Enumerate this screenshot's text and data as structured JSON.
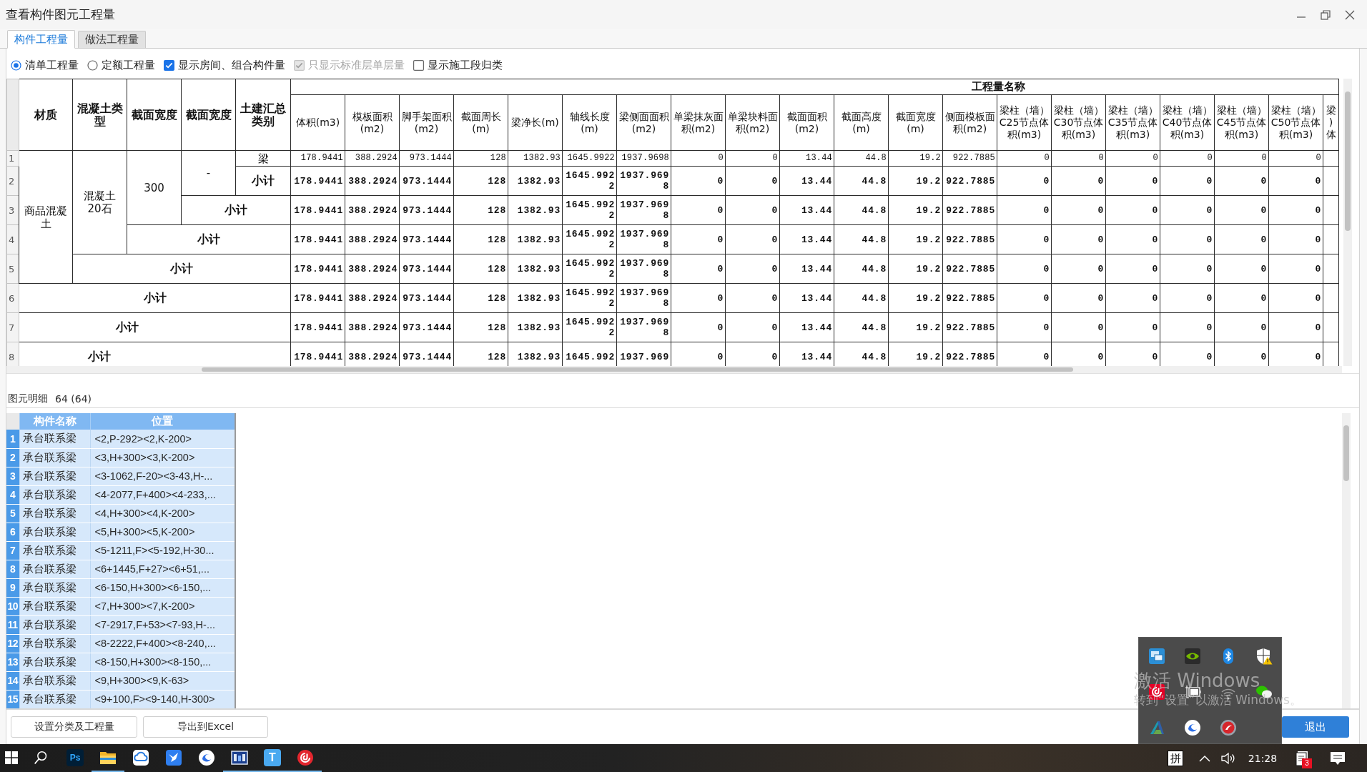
{
  "window": {
    "title": "查看构件图元工程量"
  },
  "tabs": [
    {
      "label": "构件工程量",
      "selected": true
    },
    {
      "label": "做法工程量",
      "selected": false
    }
  ],
  "options": [
    {
      "kind": "radio",
      "label": "清单工程量",
      "selected": true,
      "disabled": false
    },
    {
      "kind": "radio",
      "label": "定额工程量",
      "selected": false,
      "disabled": false
    },
    {
      "kind": "checkbox",
      "label": "显示房间、组合构件量",
      "checked": true,
      "disabled": false
    },
    {
      "kind": "checkbox",
      "label": "只显示标准层单层量",
      "checked": true,
      "disabled": true
    },
    {
      "kind": "checkbox",
      "label": "显示施工段归类",
      "checked": false,
      "disabled": false
    }
  ],
  "quantity_table": {
    "label_columns": [
      "材质",
      "混凝土类型",
      "截面宽度",
      "截面宽度",
      "土建汇总类别"
    ],
    "group_header": "工程量名称",
    "value_columns": [
      "体积(m3)",
      "模板面积(m2)",
      "脚手架面积(m2)",
      "截面周长(m)",
      "梁净长(m)",
      "轴线长度(m)",
      "梁侧面面积(m2)",
      "单梁抹灰面积(m2)",
      "单梁块料面积(m2)",
      "截面面积(m2)",
      "截面高度(m)",
      "截面宽度(m)",
      "侧面模板面积(m2)",
      "梁柱（墙）C25节点体积(m3)",
      "梁柱（墙）C30节点体积(m3)",
      "梁柱（墙）C35节点体积(m3)",
      "梁柱（墙）C40节点体积(m3)",
      "梁柱（墙）C45节点体积(m3)",
      "梁柱（墙）C50节点体积(m3)",
      "梁 ) 体"
    ],
    "groups": [
      {
        "label": "商品混凝土",
        "children": [
          {
            "label": "混凝土20石",
            "children": [
              {
                "label": "300",
                "children": [
                  {
                    "label": "-",
                    "children": [
                      {
                        "no": "1",
                        "label": "梁",
                        "values": [
                          "178.9441",
                          "388.2924",
                          "973.1444",
                          "128",
                          "1382.93",
                          "1645.9922",
                          "1937.9698",
                          "0",
                          "0",
                          "13.44",
                          "44.8",
                          "19.2",
                          "922.7885",
                          "0",
                          "0",
                          "0",
                          "0",
                          "0",
                          "0"
                        ]
                      }
                    ],
                    "subtotal": {
                      "no": "2",
                      "label": "小计",
                      "values": [
                        "178.9441",
                        "388.2924",
                        "973.1444",
                        "128",
                        "1382.93",
                        "1645.9922",
                        "1937.9698",
                        "0",
                        "0",
                        "13.44",
                        "44.8",
                        "19.2",
                        "922.7885",
                        "0",
                        "0",
                        "0",
                        "0",
                        "0",
                        "0"
                      ]
                    }
                  }
                ],
                "subtotal": {
                  "no": "3",
                  "label": "小计",
                  "values": [
                    "178.9441",
                    "388.2924",
                    "973.1444",
                    "128",
                    "1382.93",
                    "1645.9922",
                    "1937.9698",
                    "0",
                    "0",
                    "13.44",
                    "44.8",
                    "19.2",
                    "922.7885",
                    "0",
                    "0",
                    "0",
                    "0",
                    "0",
                    "0"
                  ]
                }
              }
            ],
            "subtotal": {
              "no": "4",
              "label": "小计",
              "values": [
                "178.9441",
                "388.2924",
                "973.1444",
                "128",
                "1382.93",
                "1645.9922",
                "1937.9698",
                "0",
                "0",
                "13.44",
                "44.8",
                "19.2",
                "922.7885",
                "0",
                "0",
                "0",
                "0",
                "0",
                "0"
              ]
            }
          }
        ],
        "subtotal": {
          "no": "5",
          "label": "小计",
          "values": [
            "178.9441",
            "388.2924",
            "973.1444",
            "128",
            "1382.93",
            "1645.9922",
            "1937.9698",
            "0",
            "0",
            "13.44",
            "44.8",
            "19.2",
            "922.7885",
            "0",
            "0",
            "0",
            "0",
            "0",
            "0"
          ]
        }
      }
    ],
    "outer_subtotals": [
      {
        "no": "6",
        "label": "小计",
        "values": [
          "178.9441",
          "388.2924",
          "973.1444",
          "128",
          "1382.93",
          "1645.9922",
          "1937.9698",
          "0",
          "0",
          "13.44",
          "44.8",
          "19.2",
          "922.7885",
          "0",
          "0",
          "0",
          "0",
          "0",
          "0"
        ]
      },
      {
        "no": "7",
        "label": "小计",
        "values": [
          "178.9441",
          "388.2924",
          "973.1444",
          "128",
          "1382.93",
          "1645.9922",
          "1937.9698",
          "0",
          "0",
          "13.44",
          "44.8",
          "19.2",
          "922.7885",
          "0",
          "0",
          "0",
          "0",
          "0",
          "0"
        ]
      },
      {
        "no": "8",
        "label": "小计",
        "values": [
          "178.9441",
          "388.2924",
          "973.1444",
          "128",
          "1382.93",
          "1645.992",
          "1937.969",
          "0",
          "0",
          "13.44",
          "44.8",
          "19.2",
          "922.7885",
          "0",
          "0",
          "0",
          "0",
          "0",
          "0"
        ]
      }
    ]
  },
  "detail": {
    "title": "图元明细",
    "count": "64 (64)",
    "columns": [
      "构件名称",
      "位置"
    ],
    "rows": [
      {
        "no": "1",
        "name": "承台联系梁",
        "position": "<2,P-292><2,K-200>",
        "selected": true
      },
      {
        "no": "2",
        "name": "承台联系梁",
        "position": "<3,H+300><3,K-200>",
        "selected": true
      },
      {
        "no": "3",
        "name": "承台联系梁",
        "position": "<3-1062,F-20><3-43,H-...",
        "selected": true
      },
      {
        "no": "4",
        "name": "承台联系梁",
        "position": "<4-2077,F+400><4-233,...",
        "selected": true
      },
      {
        "no": "5",
        "name": "承台联系梁",
        "position": "<4,H+300><4,K-200>",
        "selected": true
      },
      {
        "no": "6",
        "name": "承台联系梁",
        "position": "<5,H+300><5,K-200>",
        "selected": true
      },
      {
        "no": "7",
        "name": "承台联系梁",
        "position": "<5-1211,F><5-192,H-30...",
        "selected": true
      },
      {
        "no": "8",
        "name": "承台联系梁",
        "position": "<6+1445,F+27><6+51,...",
        "selected": true
      },
      {
        "no": "9",
        "name": "承台联系梁",
        "position": "<6-150,H+300><6-150,...",
        "selected": true
      },
      {
        "no": "10",
        "name": "承台联系梁",
        "position": "<7,H+300><7,K-200>",
        "selected": true
      },
      {
        "no": "11",
        "name": "承台联系梁",
        "position": "<7-2917,F+53><7-93,H-...",
        "selected": true
      },
      {
        "no": "12",
        "name": "承台联系梁",
        "position": "<8-2222,F+400><8-240,...",
        "selected": true
      },
      {
        "no": "13",
        "name": "承台联系梁",
        "position": "<8-150,H+300><8-150,...",
        "selected": true
      },
      {
        "no": "14",
        "name": "承台联系梁",
        "position": "<9,H+300><9,K-63>",
        "selected": true
      },
      {
        "no": "15",
        "name": "承台联系梁",
        "position": "<9+100,F><9-140,H-300>",
        "selected": true
      }
    ]
  },
  "footer": {
    "buttons": [
      "设置分类及工程量",
      "导出到Excel"
    ],
    "exit": "退出"
  },
  "taskbar": {
    "apps": [
      {
        "kind": "photo",
        "label": "Ps",
        "running": false
      },
      {
        "kind": "folder",
        "running": true
      },
      {
        "kind": "cloud",
        "running": false
      },
      {
        "kind": "bird",
        "running": false
      },
      {
        "kind": "swirl",
        "running": false
      },
      {
        "kind": "screen",
        "running": true
      },
      {
        "kind": "type",
        "label": "T",
        "running": true
      },
      {
        "kind": "disc",
        "running": true
      }
    ],
    "ime": "拼",
    "clock": "21:28",
    "notification_count": "3"
  },
  "activation_notice": {
    "title": "激活 Windows",
    "hint": "转到“设置”以激活 Windows。"
  }
}
